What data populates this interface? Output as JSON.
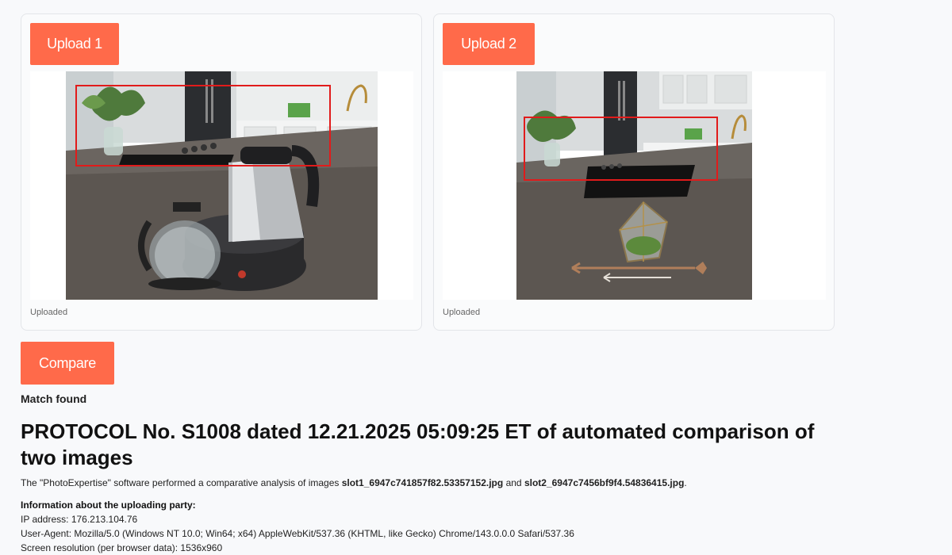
{
  "slot1": {
    "upload_label": "Upload 1",
    "status": "Uploaded",
    "image_alt": "Kitchen countertop with electric kettle and teapot"
  },
  "slot2": {
    "upload_label": "Upload 2",
    "status": "Uploaded",
    "image_alt": "Kitchen countertop with geometric glass terrarium and arrow decor"
  },
  "compare_label": "Compare",
  "result": "Match found",
  "protocol": {
    "title": "PROTOCOL No. S1008 dated 12.21.2025 05:09:25 ET of automated comparison of two images",
    "desc_prefix": "The \"PhotoExpertise\" software performed a comparative analysis of images",
    "file1": "slot1_6947c741857f82.53357152.jpg",
    "desc_and": "and",
    "file2": "slot2_6947c7456bf9f4.54836415.jpg",
    "desc_suffix": "."
  },
  "uploader": {
    "heading": "Information about the uploading party:",
    "ip": "IP address: 176.213.104.76",
    "user_agent": "User-Agent: Mozilla/5.0 (Windows NT 10.0; Win64; x64) AppleWebKit/537.36 (KHTML, like Gecko) Chrome/143.0.0.0 Safari/537.36",
    "resolution": "Screen resolution (per browser data): 1536x960"
  },
  "colors": {
    "accent": "#ff6a4a",
    "match_box": "#e11b1b"
  }
}
